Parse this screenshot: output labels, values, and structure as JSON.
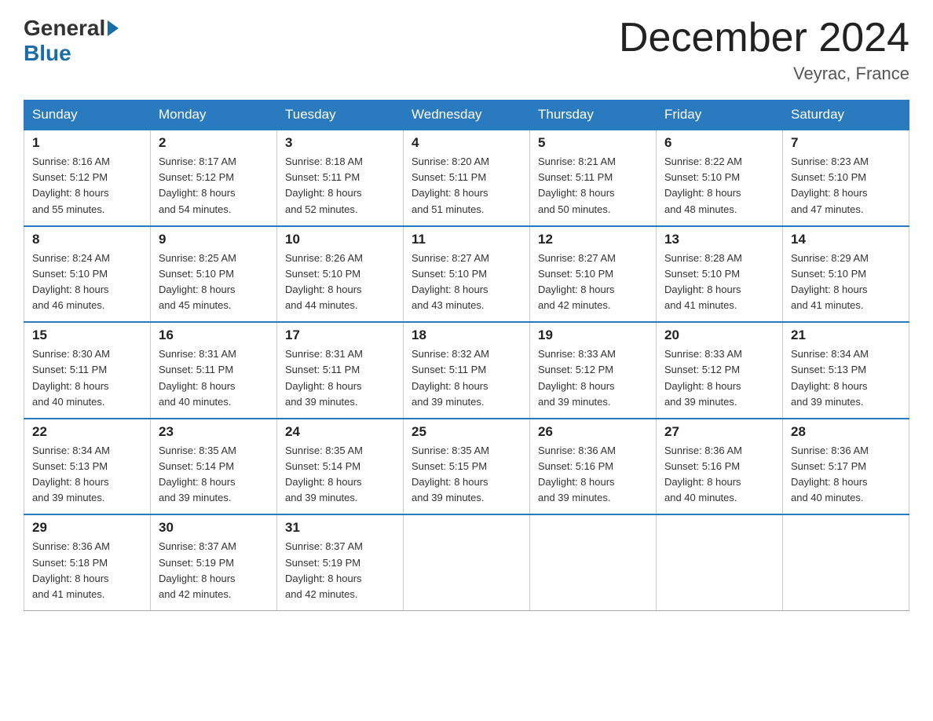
{
  "header": {
    "logo_general": "General",
    "logo_triangle": "▶",
    "logo_blue": "Blue",
    "month_title": "December 2024",
    "location": "Veyrac, France"
  },
  "weekdays": [
    "Sunday",
    "Monday",
    "Tuesday",
    "Wednesday",
    "Thursday",
    "Friday",
    "Saturday"
  ],
  "weeks": [
    [
      {
        "day": "1",
        "sunrise": "8:16 AM",
        "sunset": "5:12 PM",
        "daylight": "8 hours and 55 minutes."
      },
      {
        "day": "2",
        "sunrise": "8:17 AM",
        "sunset": "5:12 PM",
        "daylight": "8 hours and 54 minutes."
      },
      {
        "day": "3",
        "sunrise": "8:18 AM",
        "sunset": "5:11 PM",
        "daylight": "8 hours and 52 minutes."
      },
      {
        "day": "4",
        "sunrise": "8:20 AM",
        "sunset": "5:11 PM",
        "daylight": "8 hours and 51 minutes."
      },
      {
        "day": "5",
        "sunrise": "8:21 AM",
        "sunset": "5:11 PM",
        "daylight": "8 hours and 50 minutes."
      },
      {
        "day": "6",
        "sunrise": "8:22 AM",
        "sunset": "5:10 PM",
        "daylight": "8 hours and 48 minutes."
      },
      {
        "day": "7",
        "sunrise": "8:23 AM",
        "sunset": "5:10 PM",
        "daylight": "8 hours and 47 minutes."
      }
    ],
    [
      {
        "day": "8",
        "sunrise": "8:24 AM",
        "sunset": "5:10 PM",
        "daylight": "8 hours and 46 minutes."
      },
      {
        "day": "9",
        "sunrise": "8:25 AM",
        "sunset": "5:10 PM",
        "daylight": "8 hours and 45 minutes."
      },
      {
        "day": "10",
        "sunrise": "8:26 AM",
        "sunset": "5:10 PM",
        "daylight": "8 hours and 44 minutes."
      },
      {
        "day": "11",
        "sunrise": "8:27 AM",
        "sunset": "5:10 PM",
        "daylight": "8 hours and 43 minutes."
      },
      {
        "day": "12",
        "sunrise": "8:27 AM",
        "sunset": "5:10 PM",
        "daylight": "8 hours and 42 minutes."
      },
      {
        "day": "13",
        "sunrise": "8:28 AM",
        "sunset": "5:10 PM",
        "daylight": "8 hours and 41 minutes."
      },
      {
        "day": "14",
        "sunrise": "8:29 AM",
        "sunset": "5:10 PM",
        "daylight": "8 hours and 41 minutes."
      }
    ],
    [
      {
        "day": "15",
        "sunrise": "8:30 AM",
        "sunset": "5:11 PM",
        "daylight": "8 hours and 40 minutes."
      },
      {
        "day": "16",
        "sunrise": "8:31 AM",
        "sunset": "5:11 PM",
        "daylight": "8 hours and 40 minutes."
      },
      {
        "day": "17",
        "sunrise": "8:31 AM",
        "sunset": "5:11 PM",
        "daylight": "8 hours and 39 minutes."
      },
      {
        "day": "18",
        "sunrise": "8:32 AM",
        "sunset": "5:11 PM",
        "daylight": "8 hours and 39 minutes."
      },
      {
        "day": "19",
        "sunrise": "8:33 AM",
        "sunset": "5:12 PM",
        "daylight": "8 hours and 39 minutes."
      },
      {
        "day": "20",
        "sunrise": "8:33 AM",
        "sunset": "5:12 PM",
        "daylight": "8 hours and 39 minutes."
      },
      {
        "day": "21",
        "sunrise": "8:34 AM",
        "sunset": "5:13 PM",
        "daylight": "8 hours and 39 minutes."
      }
    ],
    [
      {
        "day": "22",
        "sunrise": "8:34 AM",
        "sunset": "5:13 PM",
        "daylight": "8 hours and 39 minutes."
      },
      {
        "day": "23",
        "sunrise": "8:35 AM",
        "sunset": "5:14 PM",
        "daylight": "8 hours and 39 minutes."
      },
      {
        "day": "24",
        "sunrise": "8:35 AM",
        "sunset": "5:14 PM",
        "daylight": "8 hours and 39 minutes."
      },
      {
        "day": "25",
        "sunrise": "8:35 AM",
        "sunset": "5:15 PM",
        "daylight": "8 hours and 39 minutes."
      },
      {
        "day": "26",
        "sunrise": "8:36 AM",
        "sunset": "5:16 PM",
        "daylight": "8 hours and 39 minutes."
      },
      {
        "day": "27",
        "sunrise": "8:36 AM",
        "sunset": "5:16 PM",
        "daylight": "8 hours and 40 minutes."
      },
      {
        "day": "28",
        "sunrise": "8:36 AM",
        "sunset": "5:17 PM",
        "daylight": "8 hours and 40 minutes."
      }
    ],
    [
      {
        "day": "29",
        "sunrise": "8:36 AM",
        "sunset": "5:18 PM",
        "daylight": "8 hours and 41 minutes."
      },
      {
        "day": "30",
        "sunrise": "8:37 AM",
        "sunset": "5:19 PM",
        "daylight": "8 hours and 42 minutes."
      },
      {
        "day": "31",
        "sunrise": "8:37 AM",
        "sunset": "5:19 PM",
        "daylight": "8 hours and 42 minutes."
      },
      null,
      null,
      null,
      null
    ]
  ],
  "labels": {
    "sunrise": "Sunrise:",
    "sunset": "Sunset:",
    "daylight": "Daylight:"
  }
}
